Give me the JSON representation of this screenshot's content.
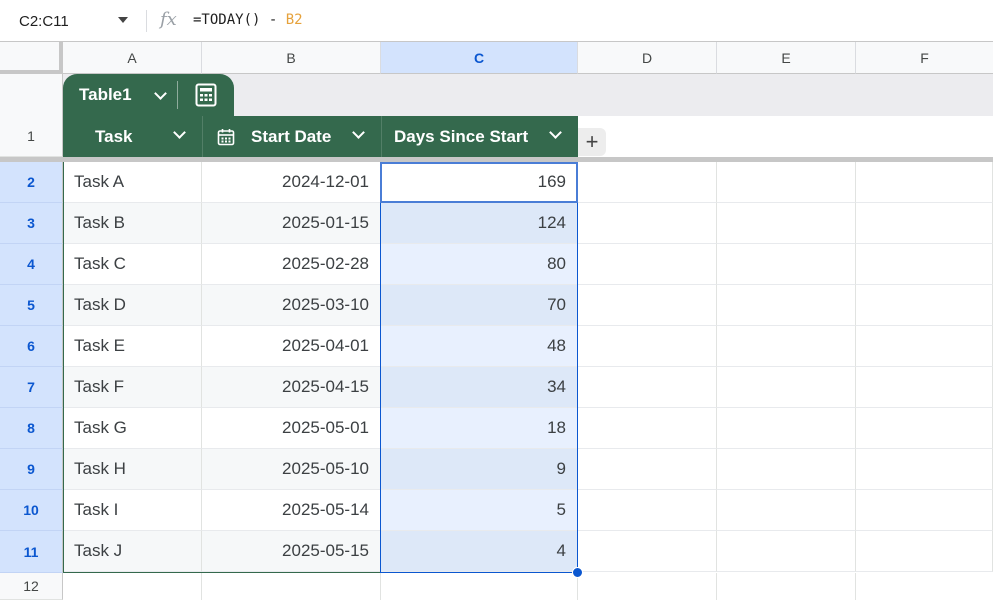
{
  "formula_bar": {
    "name_box": "C2:C11",
    "fx_label": "fx",
    "formula_prefix": "=TODAY() - ",
    "formula_ref": "B2"
  },
  "columns": [
    "A",
    "B",
    "C",
    "D",
    "E",
    "F"
  ],
  "table": {
    "name": "Table1",
    "headers": [
      "Task",
      "Start Date",
      "Days Since Start"
    ]
  },
  "row_numbers": [
    "1",
    "2",
    "3",
    "4",
    "5",
    "6",
    "7",
    "8",
    "9",
    "10",
    "11",
    "12"
  ],
  "rows": [
    {
      "task": "Task A",
      "start": "2024-12-01",
      "days": "169"
    },
    {
      "task": "Task B",
      "start": "2025-01-15",
      "days": "124"
    },
    {
      "task": "Task C",
      "start": "2025-02-28",
      "days": "80"
    },
    {
      "task": "Task D",
      "start": "2025-03-10",
      "days": "70"
    },
    {
      "task": "Task E",
      "start": "2025-04-01",
      "days": "48"
    },
    {
      "task": "Task F",
      "start": "2025-04-15",
      "days": "34"
    },
    {
      "task": "Task G",
      "start": "2025-05-01",
      "days": "18"
    },
    {
      "task": "Task H",
      "start": "2025-05-10",
      "days": "9"
    },
    {
      "task": "Task I",
      "start": "2025-05-14",
      "days": "5"
    },
    {
      "task": "Task J",
      "start": "2025-05-15",
      "days": "4"
    }
  ],
  "colors": {
    "table_header": "#34694d",
    "selection": "#0b57d0",
    "selected_fill": "#e8f0fe"
  }
}
